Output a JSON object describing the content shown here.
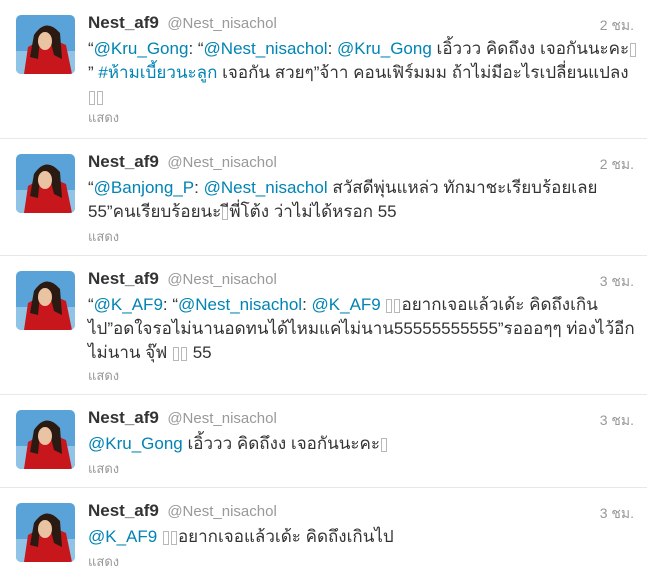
{
  "user": {
    "fullname": "Nest_af9",
    "screenname": "@Nest_nisachol"
  },
  "expand_label": "แสดง",
  "tweets": [
    {
      "time": "2 ชม.",
      "parts": [
        {
          "t": "“"
        },
        {
          "t": "@Kru_Gong",
          "link": true
        },
        {
          "t": ": “"
        },
        {
          "t": "@Nest_nisachol",
          "link": true
        },
        {
          "t": ": "
        },
        {
          "t": "@Kru_Gong",
          "link": true
        },
        {
          "t": " เอิ้ววว คิดถึงง เจอกันนะคะ"
        },
        {
          "box": true
        },
        {
          "t": "” "
        },
        {
          "t": "#ห้ามเบี้ยวนะลูก",
          "link": true
        },
        {
          "t": " เจอกัน สวยๆ”จ้าา คอนเฟิร์มมม ถ้าไม่มีอะไรเปลี่ยนแปลง "
        },
        {
          "box": true
        },
        {
          "box": true
        }
      ]
    },
    {
      "time": "2 ชม.",
      "parts": [
        {
          "t": "“"
        },
        {
          "t": "@Banjong_P",
          "link": true
        },
        {
          "t": ": "
        },
        {
          "t": "@Nest_nisachol",
          "link": true
        },
        {
          "t": " สวัสดีพุ่นแหล่ว ทักมาชะเรียบร้อยเลย 55”คนเรียบร้อยนะ"
        },
        {
          "box": true
        },
        {
          "t": "ีพี่โต้ง ว่าไม่ได้หรอก 55"
        }
      ]
    },
    {
      "time": "3 ชม.",
      "parts": [
        {
          "t": "“"
        },
        {
          "t": "@K_AF9",
          "link": true
        },
        {
          "t": ": “"
        },
        {
          "t": "@Nest_nisachol",
          "link": true
        },
        {
          "t": ": "
        },
        {
          "t": "@K_AF9",
          "link": true
        },
        {
          "t": " "
        },
        {
          "box": true
        },
        {
          "box": true
        },
        {
          "t": "อยากเจอแล้วเด้ะ คิดถึงเกินไป”อดใจรอไม่นานอดทนได้ไหมแค่ไม่นาน55555555555”รอออๆๆ ท่องไว้อีกไม่นาน จุ๊ฟ "
        },
        {
          "box": true
        },
        {
          "box": true
        },
        {
          "t": " 55"
        }
      ]
    },
    {
      "time": "3 ชม.",
      "parts": [
        {
          "t": "@Kru_Gong",
          "link": true
        },
        {
          "t": " เอิ้ววว คิดถึงง เจอกันนะคะ"
        },
        {
          "box": true
        }
      ]
    },
    {
      "time": "3 ชม.",
      "parts": [
        {
          "t": "@K_AF9",
          "link": true
        },
        {
          "t": " "
        },
        {
          "box": true
        },
        {
          "box": true
        },
        {
          "t": "อยากเจอแล้วเด้ะ คิดถึงเกินไป"
        }
      ]
    }
  ],
  "colors": {
    "link": "#0084b4",
    "muted": "#999999",
    "text": "#333333",
    "divider": "#e8e8e8"
  }
}
